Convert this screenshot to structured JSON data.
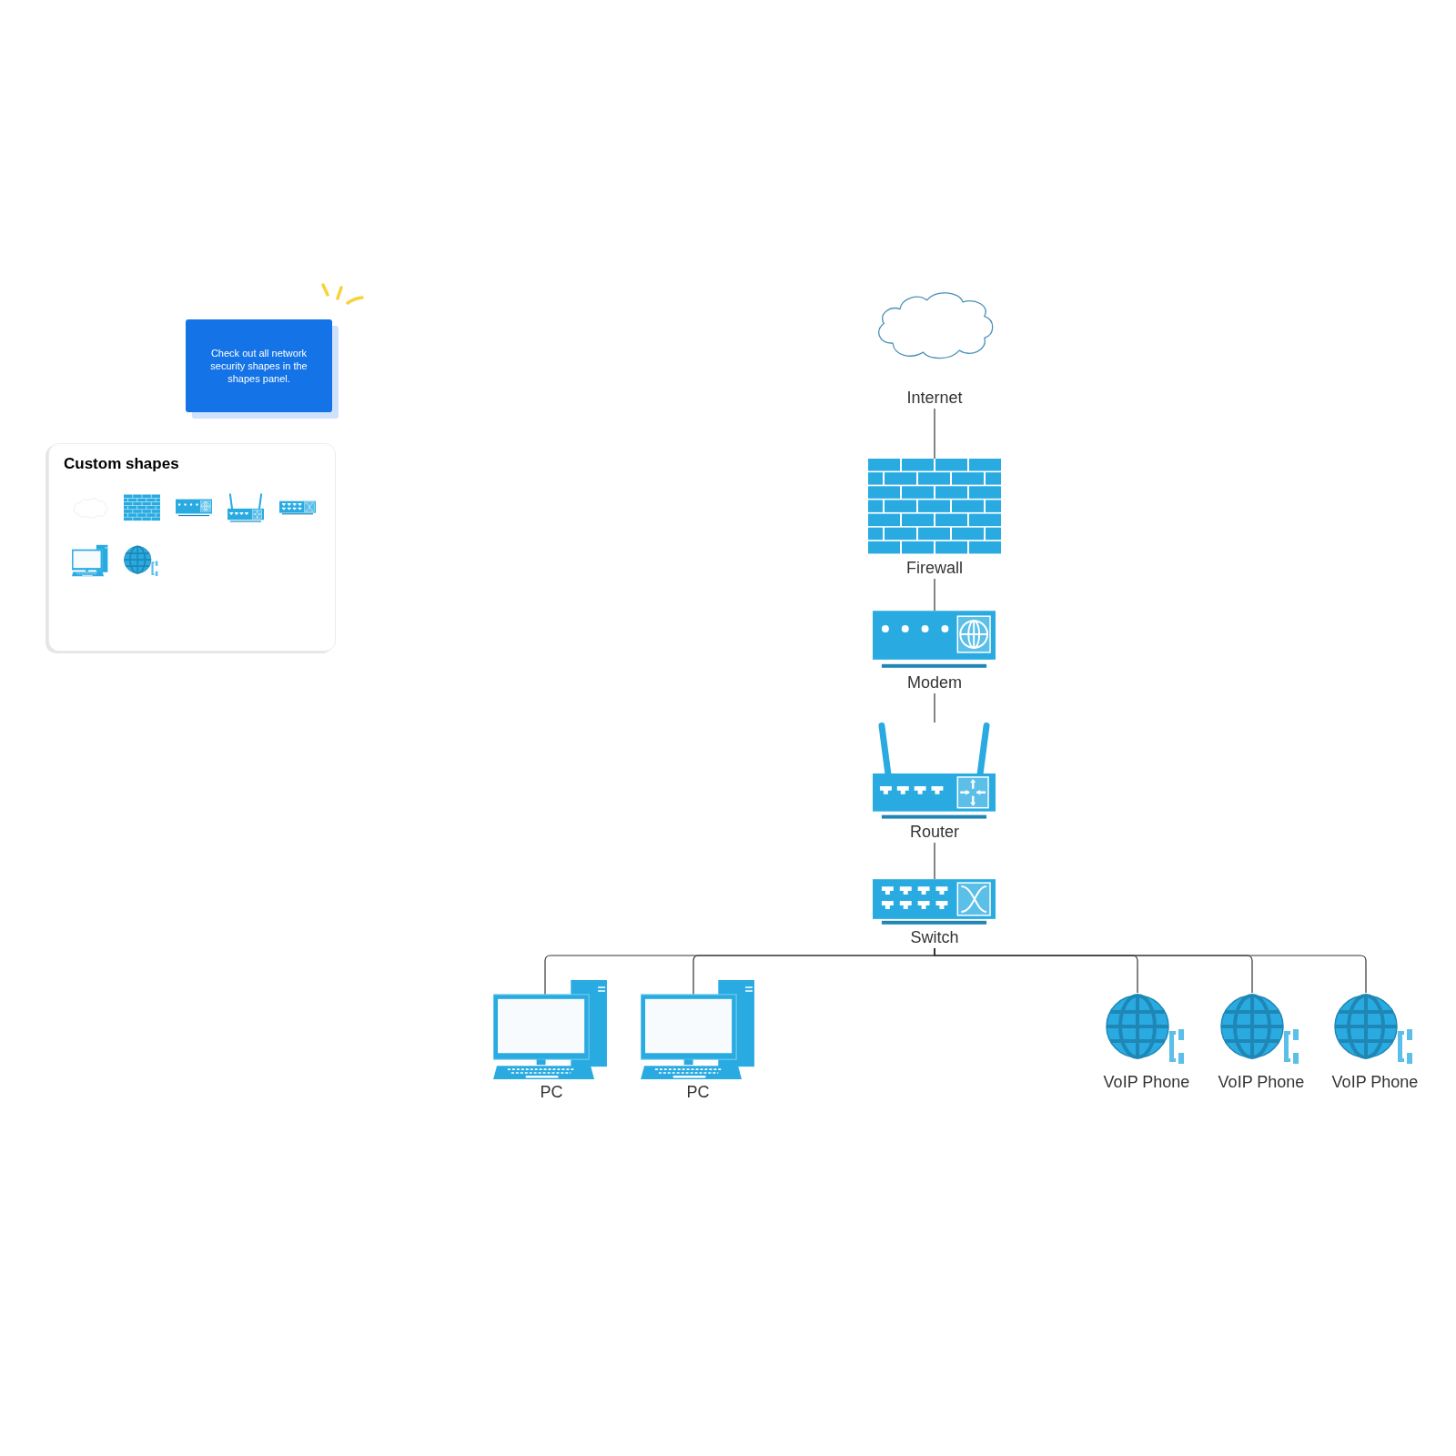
{
  "sticky_note": {
    "text": "Check out all network security shapes in the shapes panel."
  },
  "shapes_panel": {
    "title": "Custom shapes",
    "shapes": [
      {
        "kind": "cloud"
      },
      {
        "kind": "firewall"
      },
      {
        "kind": "modem"
      },
      {
        "kind": "router"
      },
      {
        "kind": "switch"
      },
      {
        "kind": "pc"
      },
      {
        "kind": "voip"
      }
    ]
  },
  "diagram": {
    "nodes": [
      {
        "kind": "cloud",
        "label": "Internet"
      },
      {
        "kind": "firewall",
        "label": "Firewall"
      },
      {
        "kind": "modem",
        "label": "Modem"
      },
      {
        "kind": "router",
        "label": "Router"
      },
      {
        "kind": "switch",
        "label": "Switch"
      },
      {
        "kind": "pc",
        "label": "PC"
      },
      {
        "kind": "pc",
        "label": "PC"
      },
      {
        "kind": "voip",
        "label": "VoIP Phone"
      },
      {
        "kind": "voip",
        "label": "VoIP Phone"
      },
      {
        "kind": "voip",
        "label": "VoIP Phone"
      }
    ]
  }
}
